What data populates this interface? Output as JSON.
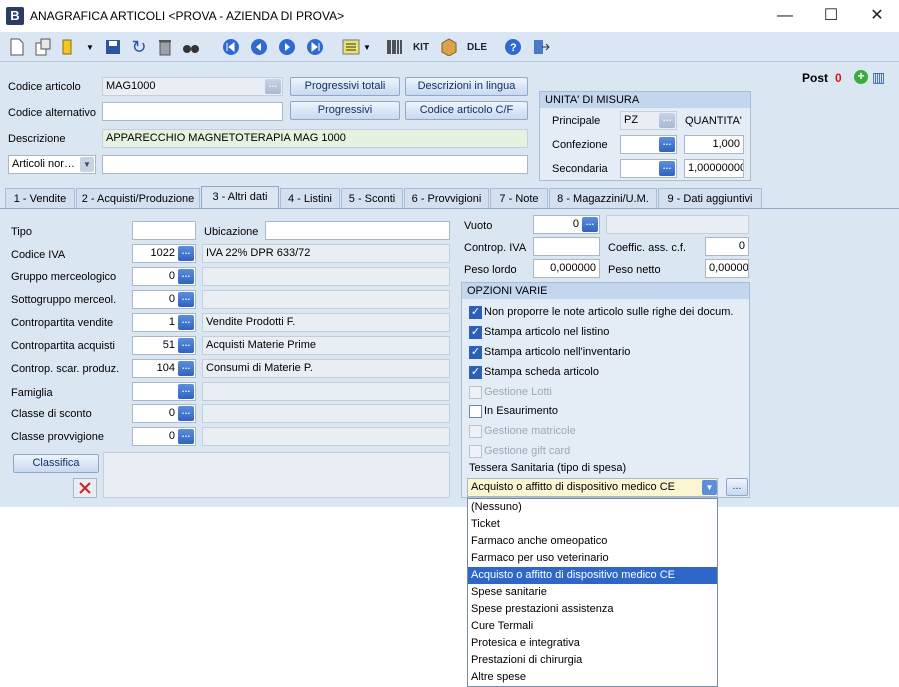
{
  "window": {
    "app_letter": "B",
    "title": "ANAGRAFICA ARTICOLI <PROVA - AZIENDA DI PROVA>",
    "minimize": "—",
    "maximize": "☐",
    "close": "✕"
  },
  "post": {
    "label": "Post",
    "count": "0"
  },
  "header": {
    "codice_articolo_label": "Codice articolo",
    "codice_articolo_value": "MAG1000",
    "codice_alternativo_label": "Codice alternativo",
    "codice_alternativo_value": "",
    "descrizione_label": "Descrizione",
    "descrizione_value": "APPARECCHIO MAGNETOTERAPIA MAG 1000",
    "articoli_combo": "Articoli nor…",
    "articoli_value": "",
    "btn_progressivi_totali": "Progressivi totali",
    "btn_descrizioni_lingua": "Descrizioni in lingua",
    "btn_progressivi": "Progressivi",
    "btn_codice_cf": "Codice articolo C/F"
  },
  "unita": {
    "title": "UNITA' DI MISURA",
    "quantita_label": "QUANTITA'",
    "principale_label": "Principale",
    "principale_value": "PZ",
    "confezione_label": "Confezione",
    "confezione_value": "",
    "confezione_qty": "1,000",
    "secondaria_label": "Secondaria",
    "secondaria_value": "",
    "secondaria_qty": "1,00000000"
  },
  "tabs": [
    "1 - Vendite",
    "2 - Acquisti/Produzione",
    "3 - Altri dati",
    "4 - Listini",
    "5 - Sconti",
    "6 - Provvigioni",
    "7 - Note",
    "8 - Magazzini/U.M.",
    "9 - Dati aggiuntivi"
  ],
  "altri": {
    "tipo_label": "Tipo",
    "tipo_value": "",
    "ubicazione_label": "Ubicazione",
    "ubicazione_value": "",
    "rows": [
      {
        "label": "Codice IVA",
        "code": "1022",
        "desc": "IVA 22% DPR 633/72"
      },
      {
        "label": "Gruppo merceologico",
        "code": "0",
        "desc": ""
      },
      {
        "label": "Sottogruppo merceol.",
        "code": "0",
        "desc": ""
      },
      {
        "label": "Contropartita vendite",
        "code": "1",
        "desc": "Vendite Prodotti F."
      },
      {
        "label": "Contropartita acquisti",
        "code": "51",
        "desc": "Acquisti Materie Prime"
      },
      {
        "label": "Controp. scar. produz.",
        "code": "104",
        "desc": "Consumi di Materie P."
      },
      {
        "label": "Famiglia",
        "code": "",
        "desc": ""
      },
      {
        "label": "Classe di sconto",
        "code": "0",
        "desc": ""
      },
      {
        "label": "Classe provvigione",
        "code": "0",
        "desc": ""
      }
    ],
    "btn_classifica": "Classifica"
  },
  "right": {
    "vuoto_label": "Vuoto",
    "vuoto_value": "0",
    "vuoto_desc": "",
    "controp_iva_label": "Controp. IVA",
    "controp_iva_value": "",
    "coeff_label": "Coeffic. ass. c.f.",
    "coeff_value": "0",
    "peso_lordo_label": "Peso lordo",
    "peso_lordo_value": "0,000000",
    "peso_netto_label": "Peso netto",
    "peso_netto_value": "0,00000"
  },
  "opzioni": {
    "title": "OPZIONI VARIE",
    "items": [
      {
        "label": "Non proporre le note articolo sulle righe dei docum.",
        "state": "on"
      },
      {
        "label": "Stampa articolo nel listino",
        "state": "on"
      },
      {
        "label": "Stampa articolo nell'inventario",
        "state": "on"
      },
      {
        "label": "Stampa scheda articolo",
        "state": "on"
      },
      {
        "label": "Gestione Lotti",
        "state": "dis"
      },
      {
        "label": "In Esaurimento",
        "state": "off"
      },
      {
        "label": "Gestione matricole",
        "state": "dis"
      },
      {
        "label": "Gestione gift card",
        "state": "dis"
      }
    ],
    "tessera_label": "Tessera Sanitaria (tipo di spesa)",
    "tessera_value": "Acquisto o affitto di dispositivo medico CE"
  },
  "dropdown": {
    "options": [
      "(Nessuno)",
      "Ticket",
      "Farmaco anche omeopatico",
      "Farmaco per uso veterinario",
      "Acquisto o affitto di dispositivo medico CE",
      "Spese sanitarie",
      "Spese prestazioni assistenza",
      "Cure Termali",
      "Protesica e integrativa",
      "Prestazioni di chirurgia",
      "Altre spese"
    ],
    "selected": "Acquisto o affitto di dispositivo medico CE"
  }
}
